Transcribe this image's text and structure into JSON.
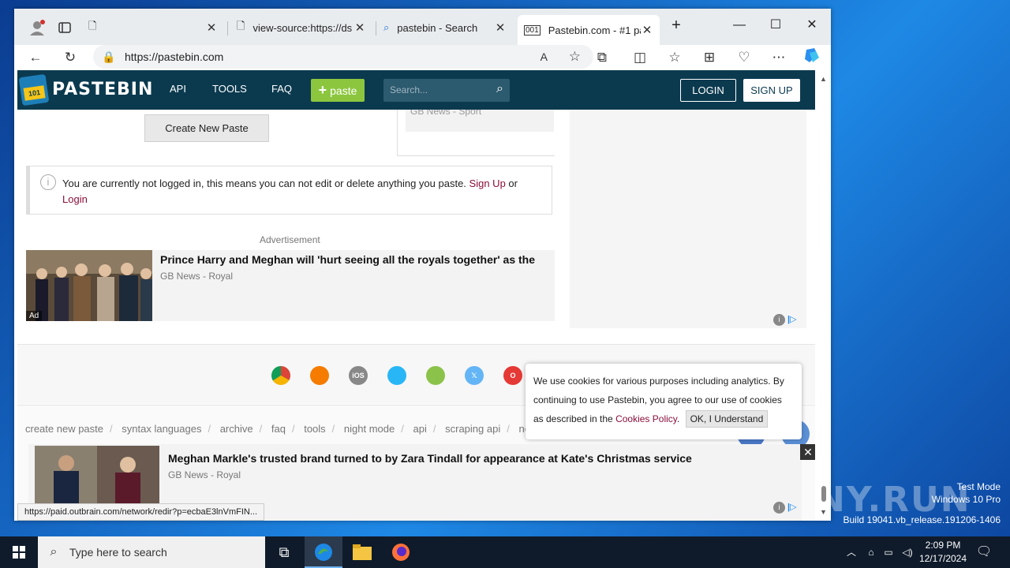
{
  "browser": {
    "tabs": [
      {
        "title": ""
      },
      {
        "title": "view-source:https://ds"
      },
      {
        "title": "pastebin - Search"
      },
      {
        "title": "Pastebin.com - #1 pas"
      }
    ],
    "address_url": "https://pastebin.com",
    "status_url": "https://paid.outbrain.com/network/redir?p=ecbaE3lnVmFIN..."
  },
  "pastebin": {
    "brand": "PASTEBIN",
    "nav": {
      "api": "API",
      "tools": "TOOLS",
      "faq": "FAQ"
    },
    "paste_button": "paste",
    "search_placeholder": "Search...",
    "login": "LOGIN",
    "signup": "SIGN UP",
    "create_new_paste": "Create New Paste",
    "side_teaser_source": "GB News - Sport",
    "notice": {
      "text": "You are currently not logged in, this means you can not edit or delete anything you paste.",
      "signup_link": "Sign Up",
      "or": "or",
      "login_link": "Login"
    },
    "advertisement_label": "Advertisement",
    "ad1": {
      "title": "Prince Harry and Meghan will 'hurt seeing all the royals together' as the",
      "source": "GB News - Royal",
      "badge": "Ad"
    },
    "apps": [
      "chrome",
      "firefox",
      "iOS",
      "windows",
      "android",
      "x",
      "opera"
    ],
    "footer_links": [
      "create new paste",
      "syntax languages",
      "archive",
      "faq",
      "tools",
      "night mode",
      "api",
      "scraping api",
      "new"
    ],
    "cookie": {
      "text": "We use cookies for various purposes including analytics. By continuing to use Pastebin, you agree to our use of cookies as described in the",
      "policy_link": "Cookies Policy",
      "ok_button": "OK, I Understand"
    },
    "bottom_ad": {
      "title": "Meghan Markle's trusted brand turned to by Zara Tindall for appearance at Kate's Christmas service",
      "source": "GB News - Royal"
    }
  },
  "taskbar": {
    "search_placeholder": "Type here to search",
    "time": "2:09 PM",
    "date": "12/17/2024"
  },
  "watermark": {
    "brand": "ANY.RUN",
    "line1": "Test Mode",
    "line2": "Windows 10 Pro",
    "line3": "Build 19041.vb_release.191206-1406"
  },
  "colors": {
    "pastebin_header": "#0b3a4f",
    "paste_green": "#8cc63f",
    "link_red": "#8b0f38"
  }
}
